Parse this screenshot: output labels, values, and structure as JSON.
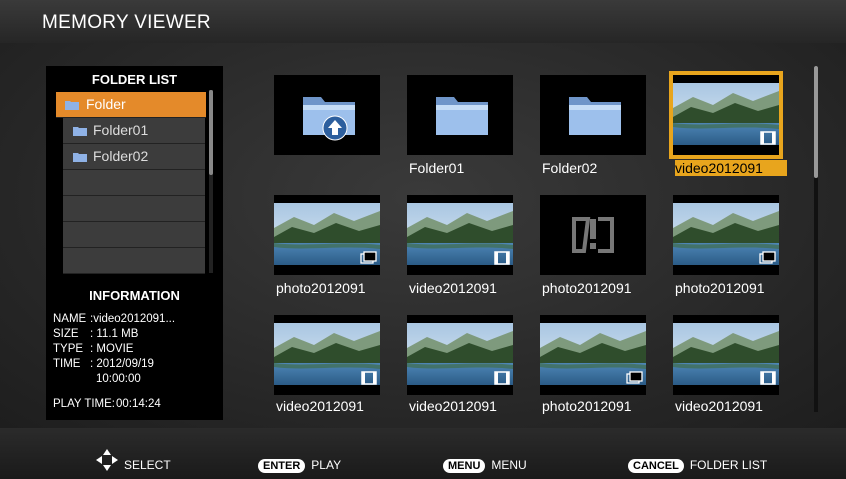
{
  "title": "MEMORY VIEWER",
  "folder_list": {
    "title": "FOLDER LIST",
    "items": [
      {
        "label": "Folder",
        "selected": true
      },
      {
        "label": "Folder01",
        "selected": false
      },
      {
        "label": "Folder02",
        "selected": false
      },
      {
        "label": "",
        "selected": false
      },
      {
        "label": "",
        "selected": false
      },
      {
        "label": "",
        "selected": false
      },
      {
        "label": "",
        "selected": false
      }
    ]
  },
  "information": {
    "title": "INFORMATION",
    "name_label": "NAME",
    "name_value": ":video2012091...",
    "size_label": "SIZE",
    "size_value": ": 11.1 MB",
    "type_label": "TYPE",
    "type_value": ": MOVIE",
    "time_label": "TIME",
    "time_value": ": 2012/09/19",
    "time_value2": "10:00:00",
    "playtime_label": "PLAY TIME:",
    "playtime_value": "00:14:24"
  },
  "grid": {
    "tiles": [
      {
        "label": "",
        "kind": "up-folder"
      },
      {
        "label": "Folder01",
        "kind": "folder"
      },
      {
        "label": "Folder02",
        "kind": "folder"
      },
      {
        "label": "video2012091",
        "kind": "video",
        "selected": true
      },
      {
        "label": "photo2012091",
        "kind": "photo"
      },
      {
        "label": "video2012091",
        "kind": "video"
      },
      {
        "label": "photo2012091",
        "kind": "error"
      },
      {
        "label": "photo2012091",
        "kind": "photo"
      },
      {
        "label": "video2012091",
        "kind": "video"
      },
      {
        "label": "video2012091",
        "kind": "video"
      },
      {
        "label": "photo2012091",
        "kind": "photo"
      },
      {
        "label": "video2012091",
        "kind": "video"
      }
    ]
  },
  "hints": {
    "select": "SELECT",
    "enter_key": "ENTER",
    "enter_action": "PLAY",
    "menu_key": "MENU",
    "menu_action": "MENU",
    "cancel_key": "CANCEL",
    "cancel_action": "FOLDER LIST"
  },
  "colors": {
    "selection": "#e48a2a",
    "tile_highlight": "#e8a51d"
  }
}
